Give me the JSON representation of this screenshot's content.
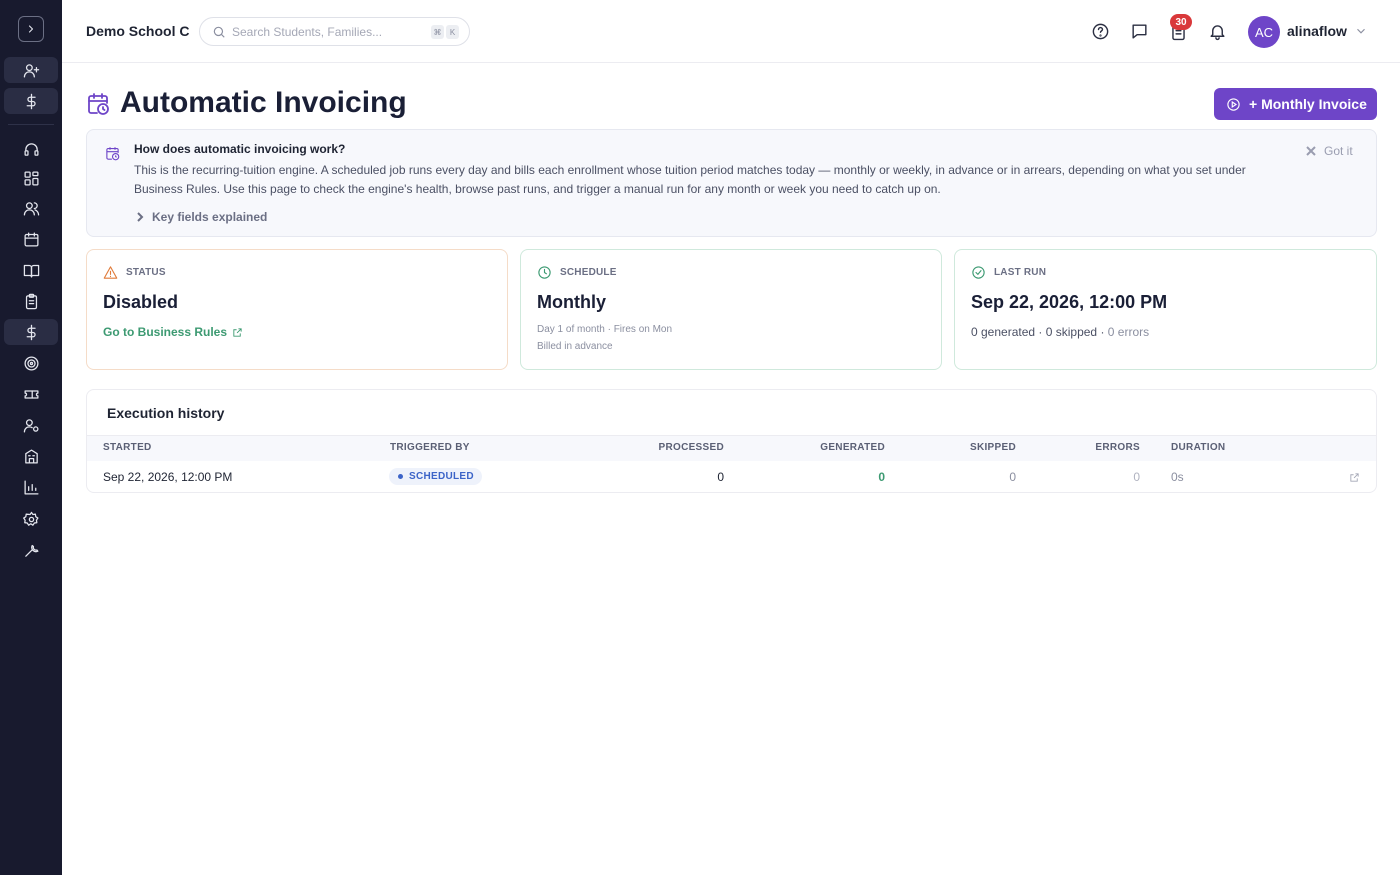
{
  "header": {
    "school_name": "Demo School C",
    "search_placeholder": "Search Students, Families...",
    "kbd_modifier": "⌘",
    "kbd_key": "K",
    "notification_count": "30",
    "user_initials": "AC",
    "username": "alinaflow"
  },
  "sidebar": {
    "icons": [
      "user-plus-icon",
      "dollar-icon",
      "headset-icon",
      "dashboard-icon",
      "users-icon",
      "calendar-icon",
      "book-icon",
      "clipboard-icon",
      "dollar-icon",
      "target-icon",
      "ticket-icon",
      "user-settings-icon",
      "building-icon",
      "chart-icon",
      "gear-icon",
      "wrench-icon"
    ],
    "active_item": "dollar-icon"
  },
  "page": {
    "title": "Automatic Invoicing",
    "primary_button": "+ Monthly Invoice"
  },
  "info": {
    "title": "How does automatic invoicing work?",
    "text": "This is the recurring-tuition engine. A scheduled job runs every day and bills each enrollment whose tuition period matches today — monthly or weekly, in advance or in arrears, depending on what you set under Business Rules. Use this page to check the engine's health, browse past runs, and trigger a manual run for any month or week you need to catch up on.",
    "dismiss": "Got it",
    "key_fields": "Key fields explained"
  },
  "cards": {
    "status": {
      "label": "STATUS",
      "value": "Disabled",
      "link": "Go to Business Rules"
    },
    "schedule": {
      "label": "SCHEDULE",
      "value": "Monthly",
      "line1": "Day 1 of month · Fires on Mon",
      "line2": "Billed in advance"
    },
    "last_run": {
      "label": "LAST RUN",
      "value": "Sep 22, 2026, 12:00 PM",
      "generated": "0 generated",
      "skipped": "0 skipped",
      "errors": "0 errors"
    }
  },
  "history": {
    "title": "Execution history",
    "columns": [
      "STARTED",
      "TRIGGERED BY",
      "PROCESSED",
      "GENERATED",
      "SKIPPED",
      "ERRORS",
      "DURATION"
    ],
    "rows": [
      {
        "started": "Sep 22, 2026, 12:00 PM",
        "triggered_by": "SCHEDULED",
        "processed": "0",
        "generated": "0",
        "skipped": "0",
        "errors": "0",
        "duration": "0s"
      }
    ]
  },
  "colors": {
    "accent": "#6e45c8",
    "sidebar": "#181a2e",
    "success": "#3d9a72",
    "warning": "#e07b3a",
    "info_pill": "#3c64c8"
  }
}
